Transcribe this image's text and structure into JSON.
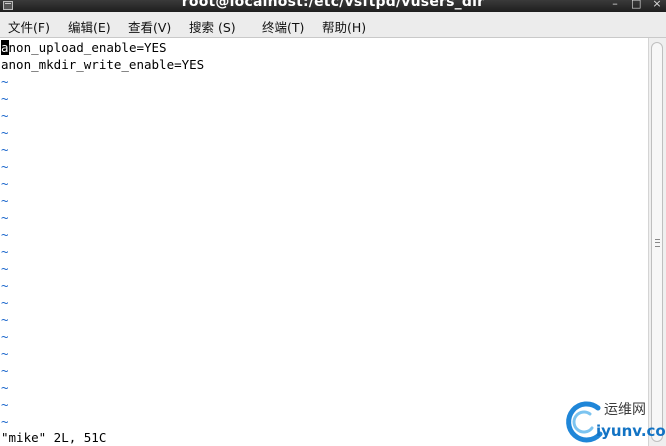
{
  "window": {
    "title": "root@localhost:/etc/vsftpd/vusers_dir"
  },
  "menu": [
    {
      "label": "文件(F)"
    },
    {
      "label": "编辑(E)"
    },
    {
      "label": "查看(V)"
    },
    {
      "label": "搜索 (S)"
    },
    {
      "label": "终端(T)"
    },
    {
      "label": "帮助(H)"
    }
  ],
  "editor": {
    "cursor_char": "a",
    "line1_rest": "non_upload_enable=YES",
    "line2": "anon_mkdir_write_enable=YES",
    "tilde": "~",
    "status": "\"mike\" 2L, 51C"
  },
  "watermark": {
    "text_cn": "运维网",
    "text_url": "iyunv.com"
  },
  "colors": {
    "tilde": "#1a66cc",
    "titlebar": "#2a2a2a"
  }
}
